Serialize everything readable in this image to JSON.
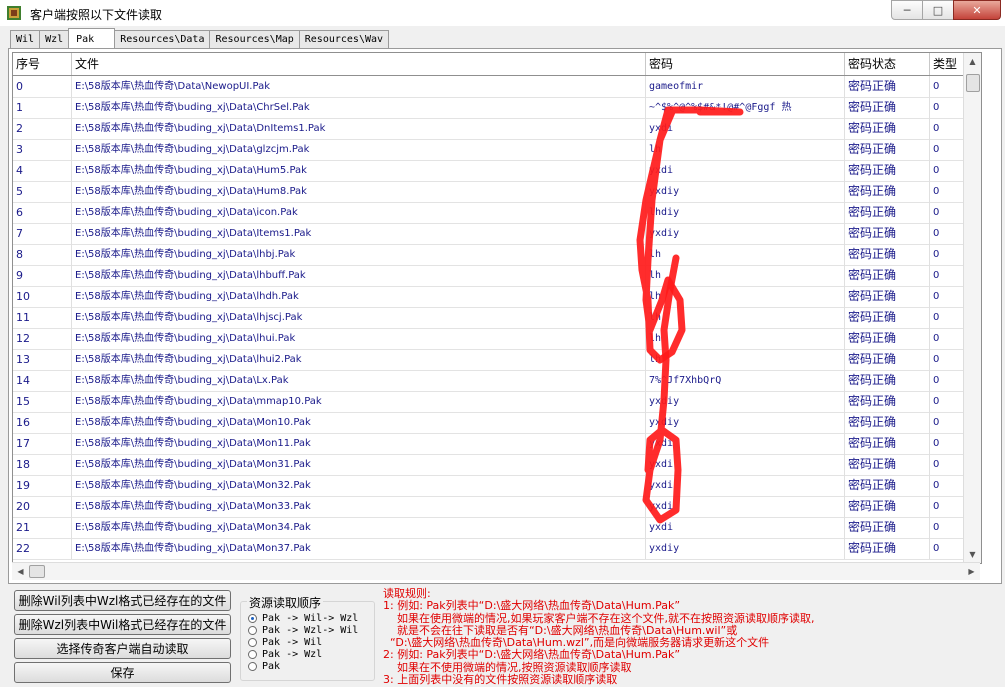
{
  "window": {
    "title": "客户端按照以下文件读取",
    "min": "─",
    "max": "□",
    "close": "✕"
  },
  "tabs": [
    "Wil",
    "Wzl",
    "Pak",
    "Resources\\Data",
    "Resources\\Map",
    "Resources\\Wav"
  ],
  "active_tab": "Pak",
  "table": {
    "headers": [
      "序号",
      "文件",
      "密码",
      "密码状态",
      "类型"
    ],
    "rows": [
      [
        "0",
        "E:\\58版本库\\热血传奇\\Data\\NewopUI.Pak",
        "gameofmir",
        "密码正确",
        "0"
      ],
      [
        "1",
        "E:\\58版本库\\热血传奇\\buding_xj\\Data\\ChrSel.Pak",
        "~^$%^@^%$#&*!@#^@Fggf 热",
        "密码正确",
        "0"
      ],
      [
        "2",
        "E:\\58版本库\\热血传奇\\buding_xj\\Data\\DnItems1.Pak",
        "yxdi",
        "密码正确",
        "0"
      ],
      [
        "3",
        "E:\\58版本库\\热血传奇\\buding_xj\\Data\\glzcjm.Pak",
        "lh",
        "密码正确",
        "0"
      ],
      [
        "4",
        "E:\\58版本库\\热血传奇\\buding_xj\\Data\\Hum5.Pak",
        "yxdi",
        "密码正确",
        "0"
      ],
      [
        "5",
        "E:\\58版本库\\热血传奇\\buding_xj\\Data\\Hum8.Pak",
        "yxdiy",
        "密码正确",
        "0"
      ],
      [
        "6",
        "E:\\58版本库\\热血传奇\\buding_xj\\Data\\icon.Pak",
        "lhdiy",
        "密码正确",
        "0"
      ],
      [
        "7",
        "E:\\58版本库\\热血传奇\\buding_xj\\Data\\Items1.Pak",
        "yxdiy",
        "密码正确",
        "0"
      ],
      [
        "8",
        "E:\\58版本库\\热血传奇\\buding_xj\\Data\\lhbj.Pak",
        "lh",
        "密码正确",
        "0"
      ],
      [
        "9",
        "E:\\58版本库\\热血传奇\\buding_xj\\Data\\lhbuff.Pak",
        "lh",
        "密码正确",
        "0"
      ],
      [
        "10",
        "E:\\58版本库\\热血传奇\\buding_xj\\Data\\lhdh.Pak",
        "lh",
        "密码正确",
        "0"
      ],
      [
        "11",
        "E:\\58版本库\\热血传奇\\buding_xj\\Data\\lhjscj.Pak",
        "lh",
        "密码正确",
        "0"
      ],
      [
        "12",
        "E:\\58版本库\\热血传奇\\buding_xj\\Data\\lhui.Pak",
        "lh",
        "密码正确",
        "0"
      ],
      [
        "13",
        "E:\\58版本库\\热血传奇\\buding_xj\\Data\\lhui2.Pak",
        "lh",
        "密码正确",
        "0"
      ],
      [
        "14",
        "E:\\58版本库\\热血传奇\\buding_xj\\Data\\Lx.Pak",
        "7%^Jf7XhbQrQ",
        "密码正确",
        "0"
      ],
      [
        "15",
        "E:\\58版本库\\热血传奇\\buding_xj\\Data\\mmap10.Pak",
        "yxdiy",
        "密码正确",
        "0"
      ],
      [
        "16",
        "E:\\58版本库\\热血传奇\\buding_xj\\Data\\Mon10.Pak",
        "yxdiy",
        "密码正确",
        "0"
      ],
      [
        "17",
        "E:\\58版本库\\热血传奇\\buding_xj\\Data\\Mon11.Pak",
        "yxdi",
        "密码正确",
        "0"
      ],
      [
        "18",
        "E:\\58版本库\\热血传奇\\buding_xj\\Data\\Mon31.Pak",
        "yxdi",
        "密码正确",
        "0"
      ],
      [
        "19",
        "E:\\58版本库\\热血传奇\\buding_xj\\Data\\Mon32.Pak",
        "yxdi",
        "密码正确",
        "0"
      ],
      [
        "20",
        "E:\\58版本库\\热血传奇\\buding_xj\\Data\\Mon33.Pak",
        "yxdi",
        "密码正确",
        "0"
      ],
      [
        "21",
        "E:\\58版本库\\热血传奇\\buding_xj\\Data\\Mon34.Pak",
        "yxdi",
        "密码正确",
        "0"
      ],
      [
        "22",
        "E:\\58版本库\\热血传奇\\buding_xj\\Data\\Mon37.Pak",
        "yxdiy",
        "密码正确",
        "0"
      ]
    ]
  },
  "buttons": {
    "delete_wil": "删除Wil列表中Wzl格式已经存在的文件",
    "delete_wzl": "删除Wzl列表中Wil格式已经存在的文件",
    "auto_read": "选择传奇客户端自动读取",
    "save": "保存"
  },
  "resource_order": {
    "title": "资源读取顺序",
    "options": [
      "Pak -> Wil-> Wzl",
      "Pak -> Wzl-> Wil",
      "Pak -> Wil",
      "Pak -> Wzl",
      "Pak"
    ],
    "selected_index": 0
  },
  "rules": [
    "读取规则:",
    "1: 例如: Pak列表中“D:\\盛大网络\\热血传奇\\Data\\Hum.Pak”",
    "    如果在使用微端的情况,如果玩家客户端不存在这个文件,就不在按照资源读取顺序读取,",
    "    就是不会在往下读取是否有“D:\\盛大网络\\热血传奇\\Data\\Hum.wil”或",
    "  “D:\\盛大网络\\热血传奇\\Data\\Hum.wzl”,而是向微端服务器请求更新这个文件",
    "2: 例如: Pak列表中“D:\\盛大网络\\热血传奇\\Data\\Hum.Pak”",
    "    如果在不使用微端的情况,按照资源读取顺序读取",
    "3: 上面列表中没有的文件按照资源读取顺序读取"
  ],
  "colors": {
    "rules_text": "#e00000",
    "scribble": "#ff1a1a",
    "link_text": "#1a1a8a"
  }
}
